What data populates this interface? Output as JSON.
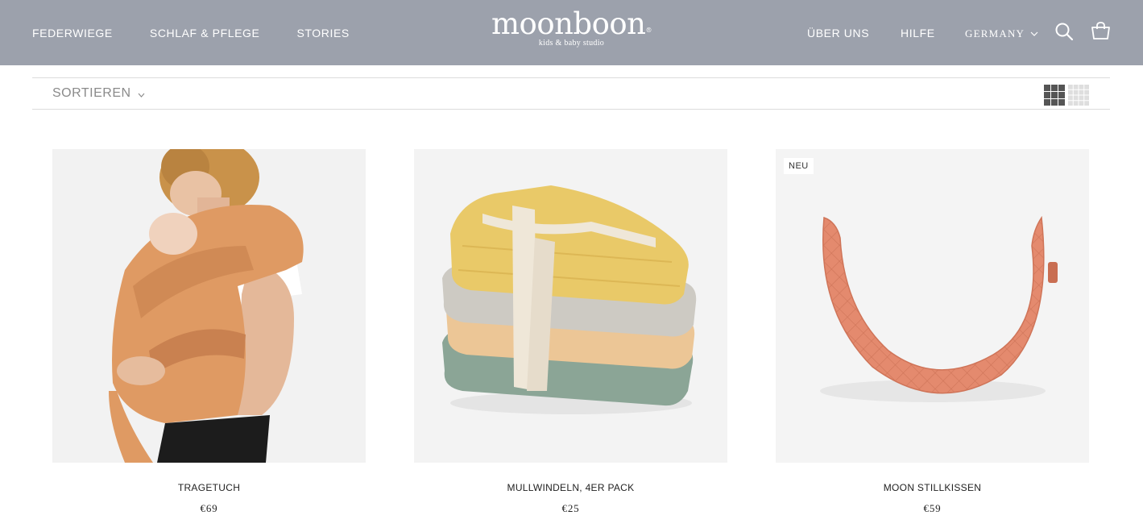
{
  "header": {
    "nav_left": [
      "FEDERWIEGE",
      "SCHLAF & PFLEGE",
      "STORIES"
    ],
    "logo": {
      "word": "moonboon",
      "registered": "®",
      "tagline": "kids & baby studio"
    },
    "nav_right": {
      "about": "ÜBER UNS",
      "help": "HILFE",
      "country": "GERMANY"
    },
    "icons": {
      "search": "search-icon",
      "cart": "shopping-bag-icon"
    },
    "background_color": "#9ca1ac"
  },
  "toolbar": {
    "sort_label": "SORTIEREN",
    "view_options": [
      "grid-3-icon",
      "grid-4-icon"
    ]
  },
  "products": [
    {
      "name": "TRAGETUCH",
      "price": "€69",
      "badge": "",
      "image": "woman wearing orange baby wrap carrier"
    },
    {
      "name": "MULLWINDELN, 4ER PACK",
      "price": "€25",
      "badge": "",
      "image": "stack of folded muslin cloths tied with ribbon"
    },
    {
      "name": "MOON STILLKISSEN",
      "price": "€59",
      "badge": "NEU",
      "image": "crescent-shaped quilted nursing pillow"
    }
  ]
}
